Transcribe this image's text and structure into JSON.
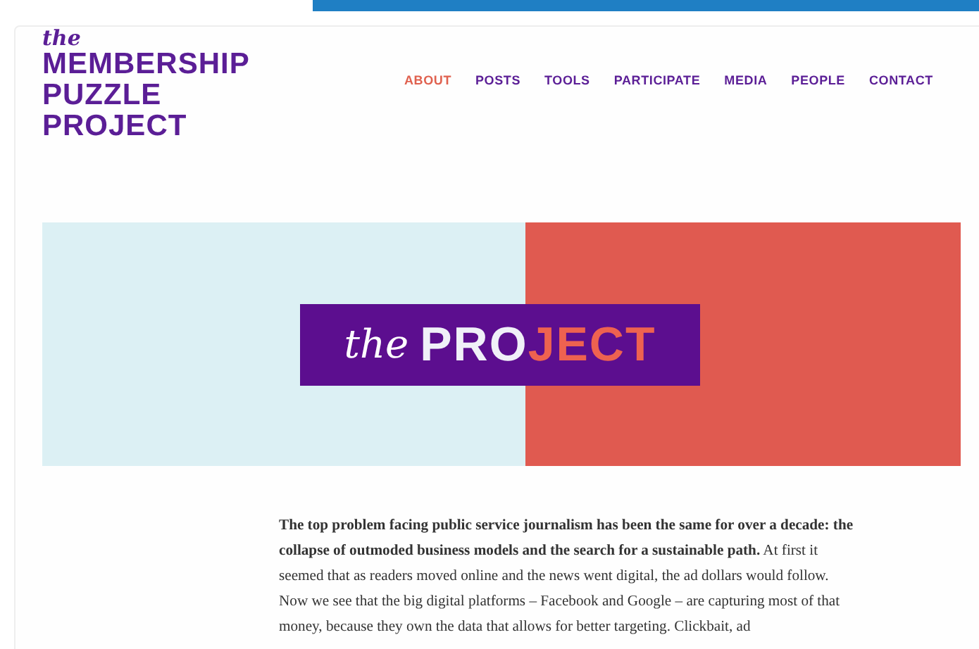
{
  "logo": {
    "script": "the",
    "lines": [
      "MEMBERSHIP",
      "PUZZLE",
      "PROJECT"
    ]
  },
  "nav": [
    {
      "label": "ABOUT",
      "selected": true
    },
    {
      "label": "POSTS",
      "selected": false
    },
    {
      "label": "TOOLS",
      "selected": false
    },
    {
      "label": "PARTICIPATE",
      "selected": false
    },
    {
      "label": "MEDIA",
      "selected": false
    },
    {
      "label": "PEOPLE",
      "selected": false
    },
    {
      "label": "CONTACT",
      "selected": false
    }
  ],
  "hero": {
    "script": "the",
    "title_start": "PRO",
    "title_end": "JECT"
  },
  "intro": "**The top problem facing public service journalism has been the same for over a decade: the collapse of outmoded business models and the search for a sustainable path.** At first it seemed that as readers moved online and the news went digital, the ad dollars would follow. Now we see that the big digital platforms – Facebook and Google – are capturing most of that money, because they own the data that allows for better targeting. Clickbait, ad"
}
